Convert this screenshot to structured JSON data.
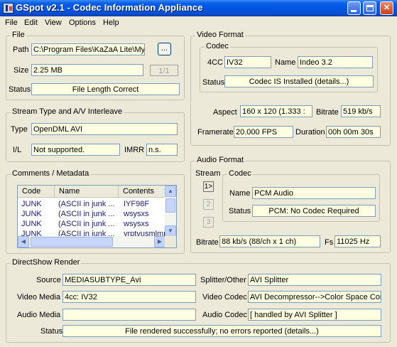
{
  "window": {
    "title": "GSpot v2.1 - Codec Information Appliance",
    "minimize": "minimize",
    "maximize": "maximize",
    "close": "close"
  },
  "menu": [
    "File",
    "Edit",
    "View",
    "Options",
    "Help"
  ],
  "file": {
    "group_label": "File",
    "path_label": "Path",
    "path_value": "C:\\Program Files\\KaZaA Lite\\My",
    "browse_label": "...",
    "size_label": "Size",
    "size_value": "2.25 MB",
    "page_counter": "1/1",
    "status_label": "Status",
    "status_value": "File Length Correct"
  },
  "stream": {
    "group_label": "Stream Type and A/V Interleave",
    "type_label": "Type",
    "type_value": "OpenDML AVI",
    "il_label": "I/L",
    "il_value": "Not supported.",
    "imrr_label": "IMRR",
    "imrr_value": "n.s."
  },
  "comments": {
    "group_label": "Comments / Metadata",
    "columns": [
      "Code",
      "Name",
      "Contents"
    ],
    "rows": [
      {
        "code": "JUNK",
        "name": "(ASCII in junk ...",
        "contents": "IYF98F"
      },
      {
        "code": "JUNK",
        "name": "(ASCII in junk ...",
        "contents": "wsysxs"
      },
      {
        "code": "JUNK",
        "name": "(ASCII in junk ...",
        "contents": "wsysxs"
      },
      {
        "code": "JUNK",
        "name": "(ASCII in junk ...",
        "contents": "yrptvusmlmn"
      }
    ]
  },
  "video": {
    "group_label": "Video Format",
    "codec_label": "Codec",
    "fourcc_label": "4CC",
    "fourcc_value": "IV32",
    "name_label": "Name",
    "name_value": "Indeo 3.2",
    "status_label": "Status",
    "status_value": "Codec IS Installed  (details...)",
    "aspect_label": "Aspect",
    "aspect_value": "160 x 120  (1.333 :",
    "bitrate_label": "Bitrate",
    "bitrate_value": "519 kb/s",
    "framerate_label": "Framerate",
    "framerate_value": "20.000 FPS",
    "duration_label": "Duration",
    "duration_value": "00h 00m 30s"
  },
  "audio": {
    "group_label": "Audio Format",
    "stream_label": "Stream",
    "stream_buttons": [
      "1>",
      "2",
      "3"
    ],
    "codec_label": "Codec",
    "name_label": "Name",
    "name_value": "PCM Audio",
    "status_label": "Status",
    "status_value": "PCM: No Codec Required",
    "bitrate_label": "Bitrate",
    "bitrate_value": "88 kb/s (88/ch x 1 ch)",
    "fs_label": "Fs",
    "fs_value": "11025 Hz"
  },
  "directshow": {
    "group_label": "DirectShow Render",
    "source_label": "Source",
    "source_value": "MEDIASUBTYPE_Avi",
    "splitter_label": "Splitter/Other",
    "splitter_value": "AVI Splitter",
    "video_media_label": "Video Media",
    "video_media_value": "4cc: IV32",
    "video_codec_label": "Video Codec",
    "video_codec_value": "AVI Decompressor-->Color Space Con",
    "audio_media_label": "Audio Media",
    "audio_media_value": "",
    "audio_codec_label": "Audio Codec",
    "audio_codec_value": "[ handled by AVI Splitter ]",
    "status_label": "Status",
    "status_value": "File rendered successfully; no errors reported   (details...)"
  }
}
